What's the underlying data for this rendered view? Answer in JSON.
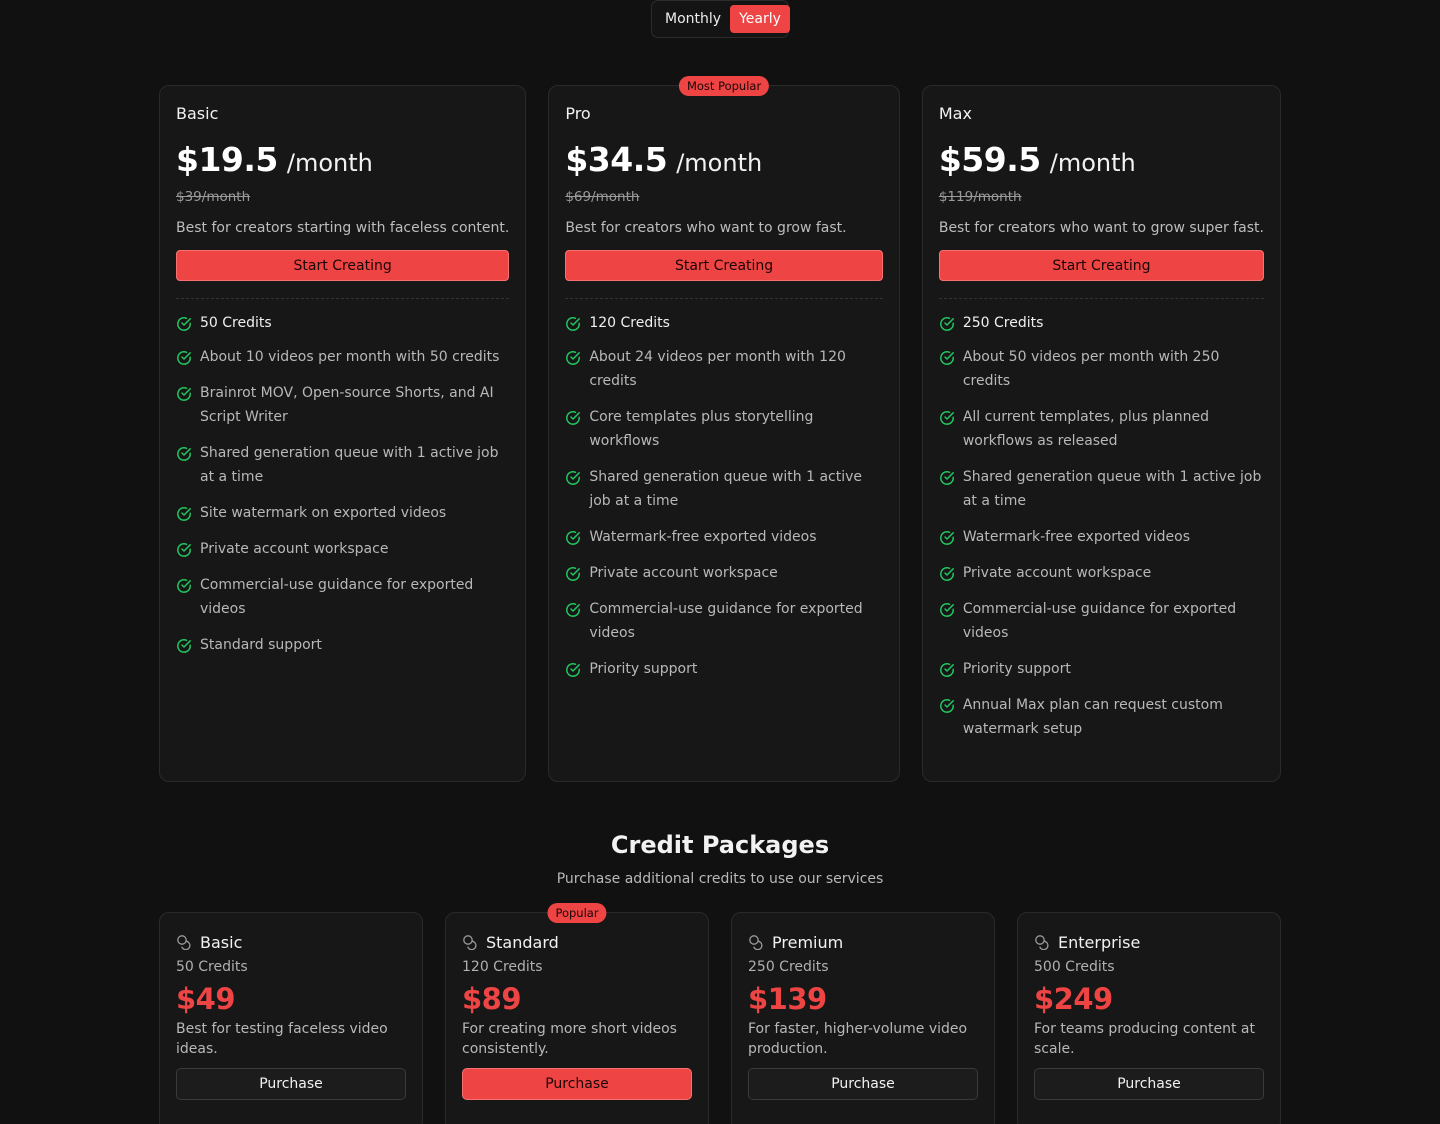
{
  "billing_toggle": {
    "monthly_label": "Monthly",
    "yearly_label": "Yearly",
    "selected": "Yearly"
  },
  "colors": {
    "background": "#111111",
    "card": "#171717",
    "accent": "#ef4444",
    "check": "#22c55e"
  },
  "plans": [
    {
      "name": "Basic",
      "badge": "",
      "price": "$19.5",
      "per": "/month",
      "old_price": "$39/month",
      "description": "Best for creators starting with faceless content.",
      "cta": "Start Creating",
      "features": [
        "50 Credits",
        "About 10 videos per month with 50 credits",
        "Brainrot MOV, Open-source Shorts, and AI Script Writer",
        "Shared generation queue with 1 active job at a time",
        "Site watermark on exported videos",
        "Private account workspace",
        "Commercial-use guidance for exported videos",
        "Standard support"
      ]
    },
    {
      "name": "Pro",
      "badge": "Most Popular",
      "price": "$34.5",
      "per": "/month",
      "old_price": "$69/month",
      "description": "Best for creators who want to grow fast.",
      "cta": "Start Creating",
      "features": [
        "120 Credits",
        "About 24 videos per month with 120 credits",
        "Core templates plus storytelling workflows",
        "Shared generation queue with 1 active job at a time",
        "Watermark-free exported videos",
        "Private account workspace",
        "Commercial-use guidance for exported videos",
        "Priority support"
      ]
    },
    {
      "name": "Max",
      "badge": "",
      "price": "$59.5",
      "per": "/month",
      "old_price": "$119/month",
      "description": "Best for creators who want to grow super fast.",
      "cta": "Start Creating",
      "features": [
        "250 Credits",
        "About 50 videos per month with 250 credits",
        "All current templates, plus planned workflows as released",
        "Shared generation queue with 1 active job at a time",
        "Watermark-free exported videos",
        "Private account workspace",
        "Commercial-use guidance for exported videos",
        "Priority support",
        "Annual Max plan can request custom watermark setup"
      ]
    }
  ],
  "credit_section": {
    "title": "Credit Packages",
    "subtitle": "Purchase additional credits to use our services"
  },
  "packages": [
    {
      "name": "Basic",
      "badge": "",
      "credits": "50 Credits",
      "price": "$49",
      "description": "Best for testing faceless video ideas.",
      "button": "Purchase",
      "highlight": false
    },
    {
      "name": "Standard",
      "badge": "Popular",
      "credits": "120 Credits",
      "price": "$89",
      "description": "For creating more short videos consistently.",
      "button": "Purchase",
      "highlight": true
    },
    {
      "name": "Premium",
      "badge": "",
      "credits": "250 Credits",
      "price": "$139",
      "description": "For faster, higher-volume video production.",
      "button": "Purchase",
      "highlight": false
    },
    {
      "name": "Enterprise",
      "badge": "",
      "credits": "500 Credits",
      "price": "$249",
      "description": "For teams producing content at scale.",
      "button": "Purchase",
      "highlight": false
    }
  ]
}
